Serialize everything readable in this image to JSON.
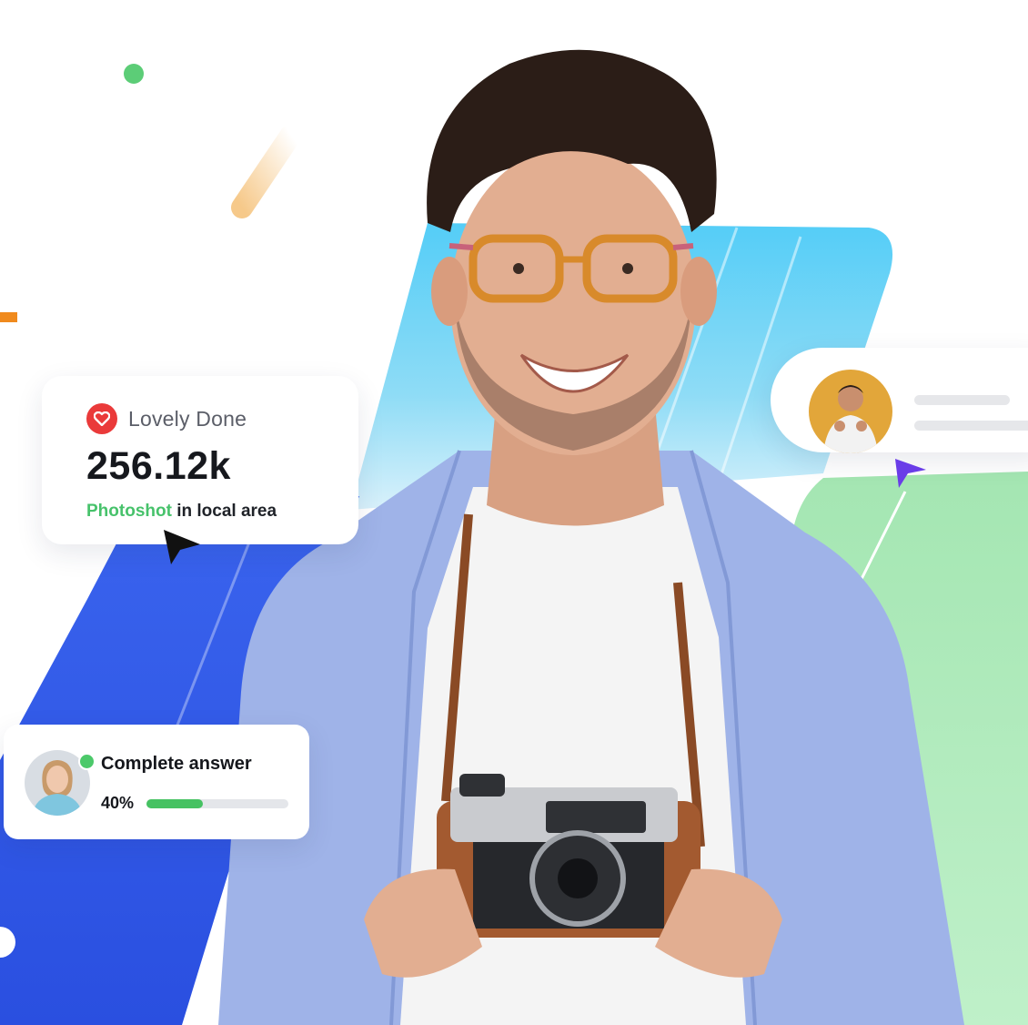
{
  "lovely_card": {
    "title": "Lovely Done",
    "value": "256.12k",
    "subtitle_accent": "Photoshot",
    "subtitle_rest": " in local area"
  },
  "answer_card": {
    "title": "Complete answer",
    "percent_label": "40%",
    "progress": 0.4
  },
  "colors": {
    "accent_green": "#47c26b",
    "heart_red": "#ea3a3a",
    "blue_shape": "#2f5bea",
    "cyan_shape": "#5fd0f5",
    "green_shape": "#a6e6b3",
    "cursor_purple": "#6a3de8"
  },
  "icons": {
    "heart": "heart-icon",
    "cursor_black": "cursor-arrow-icon",
    "cursor_purple": "cursor-arrow-icon"
  }
}
